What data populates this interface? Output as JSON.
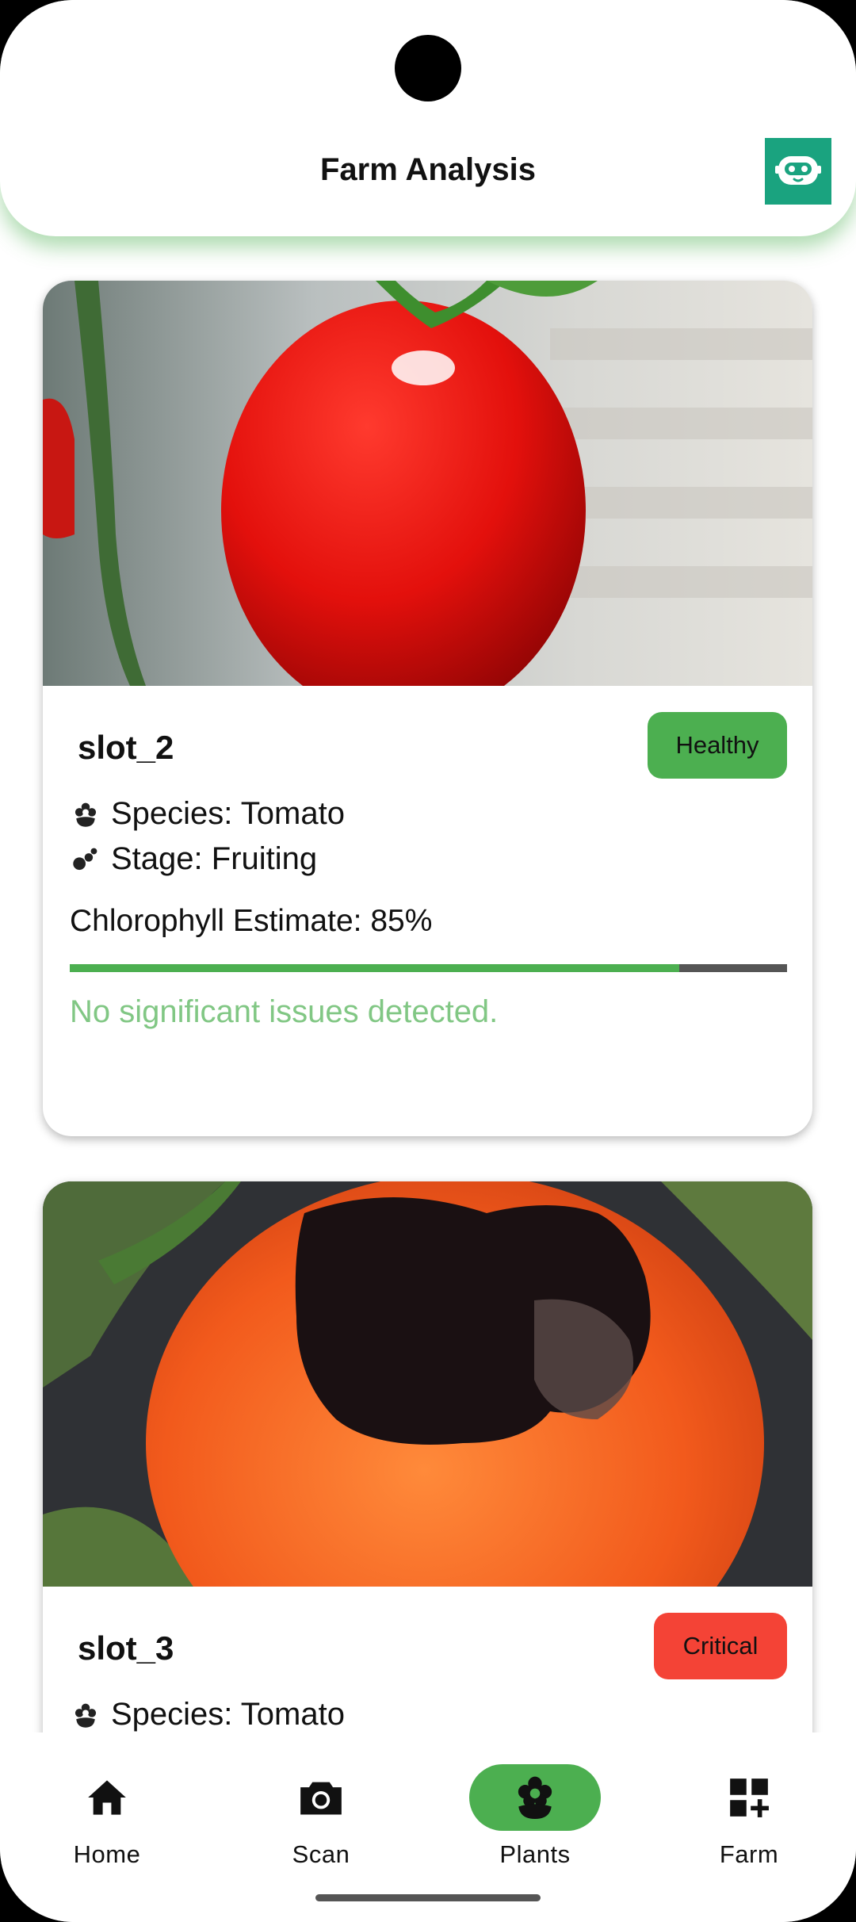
{
  "header": {
    "title": "Farm Analysis",
    "assistant_icon": "robot-icon"
  },
  "plants": [
    {
      "slot": "slot_2",
      "status": "Healthy",
      "status_color": "#4caf50",
      "species": "Species: Tomato",
      "stage": "Stage: Fruiting",
      "chlorophyll_label": "Chlorophyll Estimate: 85%",
      "chlorophyll_value": 85,
      "message": "No significant issues detected.",
      "image": "healthy red tomato"
    },
    {
      "slot": "slot_3",
      "status": "Critical",
      "status_color": "#f44336",
      "species": "Species: Tomato",
      "image": "tomato with dark rot lesion"
    }
  ],
  "nav": {
    "items": [
      {
        "label": "Home",
        "icon": "home-icon"
      },
      {
        "label": "Scan",
        "icon": "camera-icon"
      },
      {
        "label": "Plants",
        "icon": "flower-icon",
        "active": true
      },
      {
        "label": "Farm",
        "icon": "grid-add-icon"
      }
    ]
  },
  "colors": {
    "accent": "#4caf50",
    "critical": "#f44336",
    "assistant": "#1aa37f",
    "bar_track": "#555555"
  }
}
